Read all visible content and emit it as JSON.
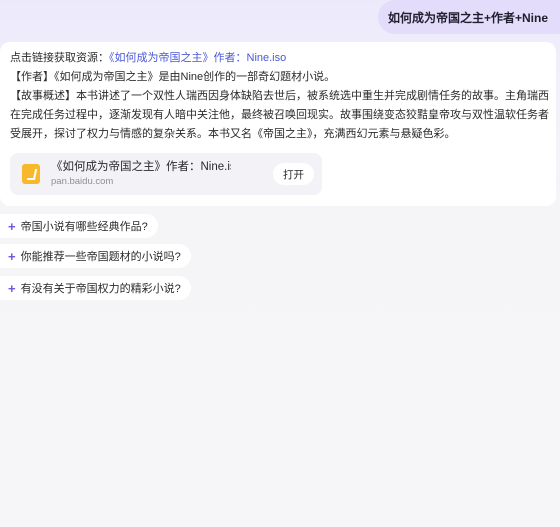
{
  "user_message": "如何成为帝国之主+作者+Nine",
  "answer": {
    "intro_prefix": "点击链接获取资源：",
    "intro_link": "《如何成为帝国之主》作者：Nine.iso",
    "author_line": "【作者】《如何成为帝国之主》是由Nine创作的一部奇幻题材小说。",
    "summary_line1": "【故事概述】本书讲述了一个双性人瑞西因身体缺陷去世后，被系统选中重生并完成剧情任务的故事。主角瑞西",
    "summary_line2": "在完成任务过程中，逐渐发现有人暗中关注他，最终被召唤回现实。故事围绕变态狡黠皇帝攻与双性温软任务者",
    "summary_line3": "受展开，探讨了权力与情感的复杂关系。本书又名《帝国之主》，充满西幻元素与悬疑色彩。"
  },
  "file_card": {
    "icon": "baidu-pan-file-icon",
    "title": "《如何成为帝国之主》作者：Nine.iso",
    "domain": "pan.baidu.com",
    "open_label": "打开"
  },
  "suggestions": [
    {
      "plus": "+",
      "text": "帝国小说有哪些经典作品?"
    },
    {
      "plus": "+",
      "text": "你能推荐一些帝国题材的小说吗?"
    },
    {
      "plus": "+",
      "text": "有没有关于帝国权力的精彩小说?"
    }
  ]
}
